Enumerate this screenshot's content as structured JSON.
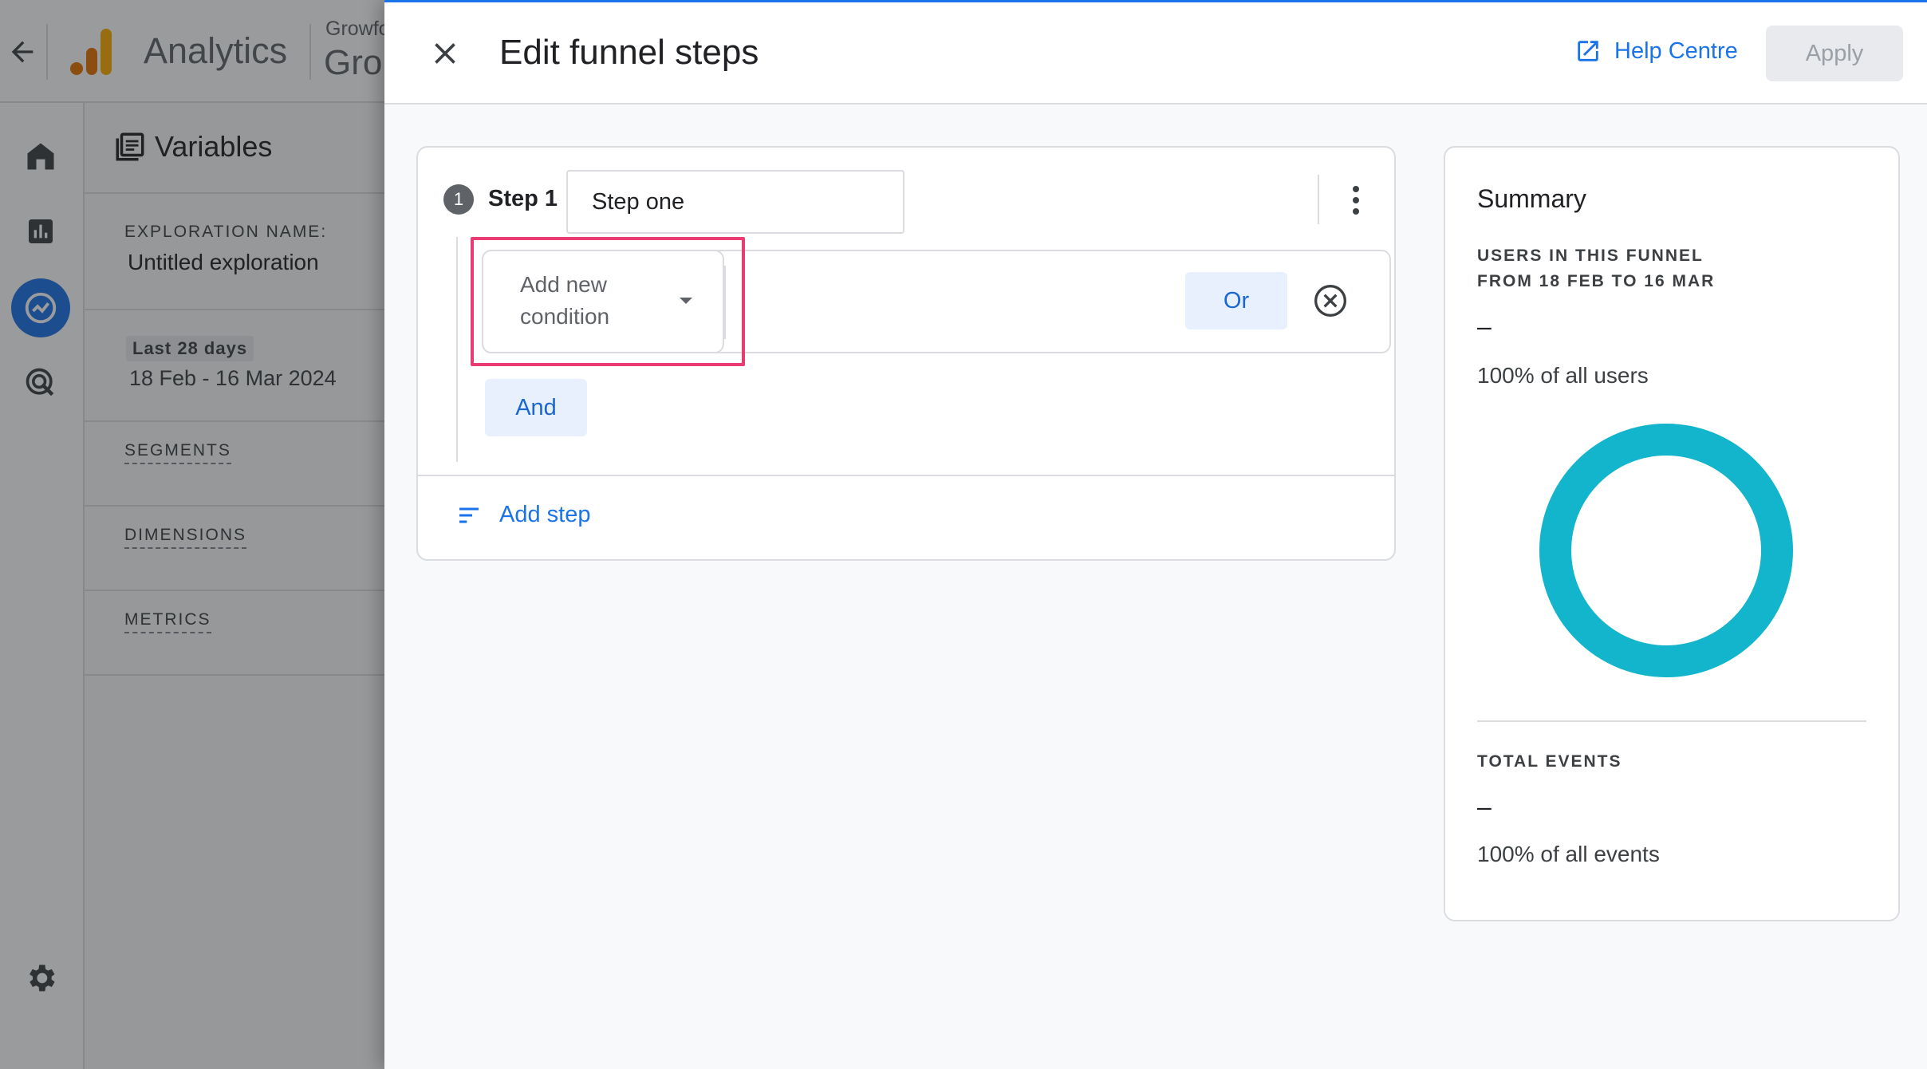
{
  "background_app": {
    "app_name": "Analytics",
    "property_small": "Growfo",
    "property_big": "Gro",
    "variables_title": "Variables",
    "exploration_label": "EXPLORATION NAME:",
    "exploration_value": "Untitled exploration",
    "date_chip": "Last 28 days",
    "date_range": "18 Feb - 16 Mar 2024",
    "segments_label": "SEGMENTS",
    "dimensions_label": "DIMENSIONS",
    "metrics_label": "METRICS"
  },
  "drawer": {
    "title": "Edit funnel steps",
    "help_link": "Help Centre",
    "apply_label": "Apply"
  },
  "step": {
    "number": "1",
    "label": "Step 1",
    "name_value": "Step one",
    "condition_placeholder": "Add new condition",
    "or_label": "Or",
    "and_label": "And",
    "add_step_label": "Add step"
  },
  "summary": {
    "title": "Summary",
    "users_label_line1": "USERS IN THIS FUNNEL",
    "users_label_line2": "FROM 18 FEB TO 16 MAR",
    "users_value": "–",
    "users_pct": "100% of all users",
    "events_label": "TOTAL EVENTS",
    "events_value": "–",
    "events_pct": "100% of all events",
    "donut_color": "#12b5cb",
    "donut_fraction": 1.0
  },
  "colors": {
    "accent": "#1a73e8",
    "highlight": "#ea3c73",
    "disabled_button": "#e8eaed"
  }
}
